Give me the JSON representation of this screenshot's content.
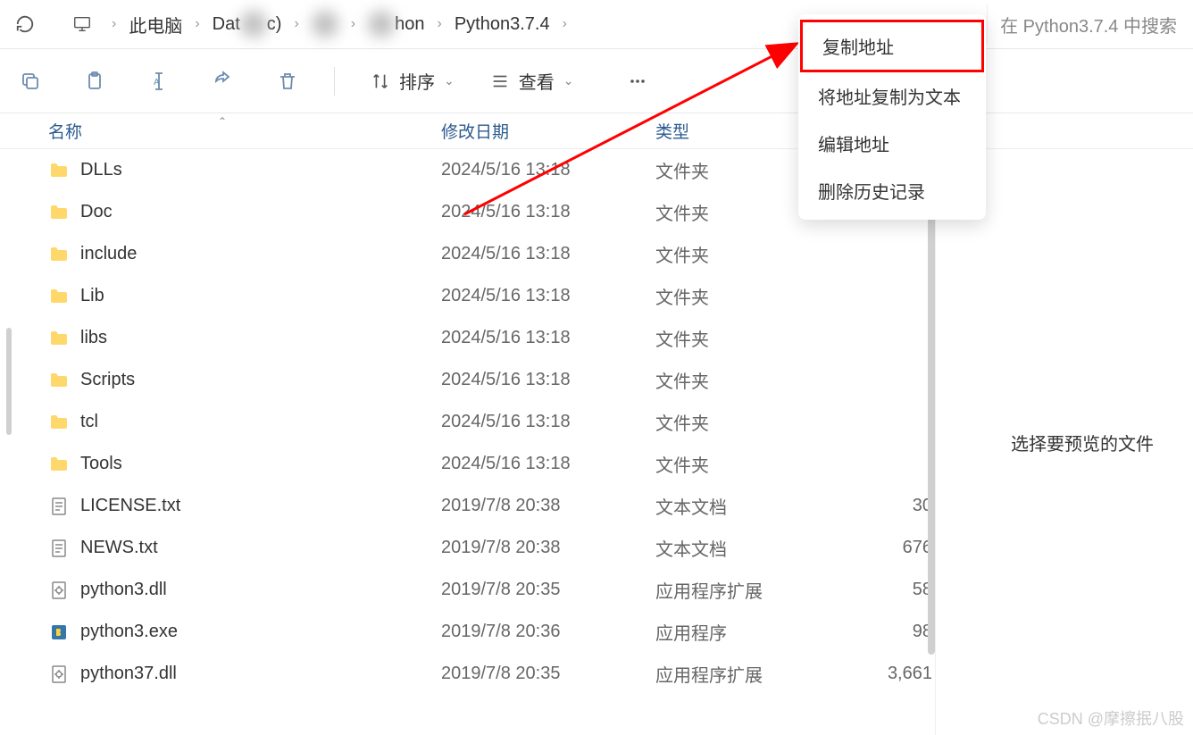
{
  "breadcrumb": {
    "items": [
      {
        "label": "此电脑",
        "icon": "monitor"
      },
      {
        "label": "Dat",
        "blurred_suffix": "c)"
      },
      {
        "label": "",
        "blurred": true
      },
      {
        "label": "hon",
        "blurred_prefix": true
      },
      {
        "label": "Python3.7.4"
      }
    ]
  },
  "search": {
    "placeholder": "在 Python3.7.4 中搜索"
  },
  "toolbar": {
    "sort_label": "排序",
    "view_label": "查看"
  },
  "columns": {
    "name": "名称",
    "date": "修改日期",
    "type": "类型",
    "size": ""
  },
  "files": [
    {
      "icon": "folder",
      "name": "DLLs",
      "date": "2024/5/16 13:18",
      "type": "文件夹",
      "size": ""
    },
    {
      "icon": "folder",
      "name": "Doc",
      "date": "2024/5/16 13:18",
      "type": "文件夹",
      "size": ""
    },
    {
      "icon": "folder",
      "name": "include",
      "date": "2024/5/16 13:18",
      "type": "文件夹",
      "size": ""
    },
    {
      "icon": "folder",
      "name": "Lib",
      "date": "2024/5/16 13:18",
      "type": "文件夹",
      "size": ""
    },
    {
      "icon": "folder",
      "name": "libs",
      "date": "2024/5/16 13:18",
      "type": "文件夹",
      "size": ""
    },
    {
      "icon": "folder",
      "name": "Scripts",
      "date": "2024/5/16 13:18",
      "type": "文件夹",
      "size": ""
    },
    {
      "icon": "folder",
      "name": "tcl",
      "date": "2024/5/16 13:18",
      "type": "文件夹",
      "size": ""
    },
    {
      "icon": "folder",
      "name": "Tools",
      "date": "2024/5/16 13:18",
      "type": "文件夹",
      "size": ""
    },
    {
      "icon": "txt",
      "name": "LICENSE.txt",
      "date": "2019/7/8 20:38",
      "type": "文本文档",
      "size": "30"
    },
    {
      "icon": "txt",
      "name": "NEWS.txt",
      "date": "2019/7/8 20:38",
      "type": "文本文档",
      "size": "676"
    },
    {
      "icon": "dll",
      "name": "python3.dll",
      "date": "2019/7/8 20:35",
      "type": "应用程序扩展",
      "size": "58"
    },
    {
      "icon": "exe",
      "name": "python3.exe",
      "date": "2019/7/8 20:36",
      "type": "应用程序",
      "size": "98"
    },
    {
      "icon": "dll",
      "name": "python37.dll",
      "date": "2019/7/8 20:35",
      "type": "应用程序扩展",
      "size": "3,661"
    }
  ],
  "context_menu": {
    "items": [
      "复制地址",
      "将地址复制为文本",
      "编辑地址",
      "删除历史记录"
    ]
  },
  "preview": {
    "hint": "选择要预览的文件"
  },
  "watermark": "CSDN @摩擦抿八股"
}
